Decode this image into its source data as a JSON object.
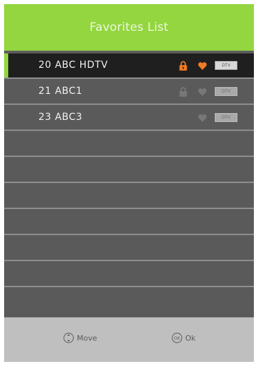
{
  "title": "Favorites List",
  "channels": [
    {
      "label": "20 ABC HDTV",
      "badge": "DTV",
      "lock": "active",
      "heart": "active"
    },
    {
      "label": "21 ABC1",
      "badge": "DTV",
      "lock": "dim",
      "heart": "dim"
    },
    {
      "label": "23 ABC3",
      "badge": "DTV",
      "lock": "hidden",
      "heart": "dim"
    }
  ],
  "footer": {
    "move_label": "Move",
    "ok_label": "Ok",
    "move_icon": "move-arrows-icon",
    "ok_icon": "ok-button-icon"
  },
  "colors": {
    "accent_green": "#93d640",
    "icon_orange": "#f07a22",
    "list_bg": "#5a5a5a",
    "selected_bg": "#1f1f1f",
    "footer_bg": "#bfbfbf"
  }
}
